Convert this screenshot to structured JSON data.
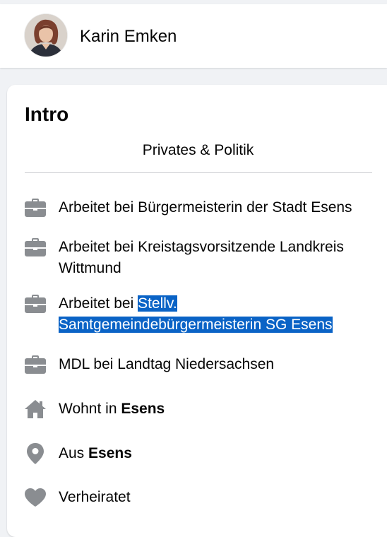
{
  "profile": {
    "name": "Karin Emken"
  },
  "intro": {
    "title": "Intro",
    "bio": "Privates & Politik",
    "items": [
      {
        "icon": "briefcase-icon",
        "prefix": "Arbeitet bei ",
        "value": "Bürgermeisterin der Stadt Esens"
      },
      {
        "icon": "briefcase-icon",
        "prefix": "Arbeitet bei ",
        "value": "Kreistagsvorsitzende Landkreis Wittmund"
      },
      {
        "icon": "briefcase-icon",
        "prefix": "Arbeitet bei ",
        "value_line1": "Stellv.",
        "value_line2": "Samtgemeindebürgermeisterin SG Esens",
        "selected": true
      },
      {
        "icon": "briefcase-icon",
        "prefix": "MDL bei ",
        "value": "Landtag Niedersachsen"
      },
      {
        "icon": "home-icon",
        "prefix": "Wohnt in ",
        "value": "Esens"
      },
      {
        "icon": "location-pin-icon",
        "prefix": "Aus ",
        "value": "Esens"
      },
      {
        "icon": "heart-icon",
        "value": "Verheiratet"
      }
    ]
  },
  "colors": {
    "selection": "#0a63c6",
    "icon": "#8a8d91",
    "background": "#f0f2f5"
  }
}
